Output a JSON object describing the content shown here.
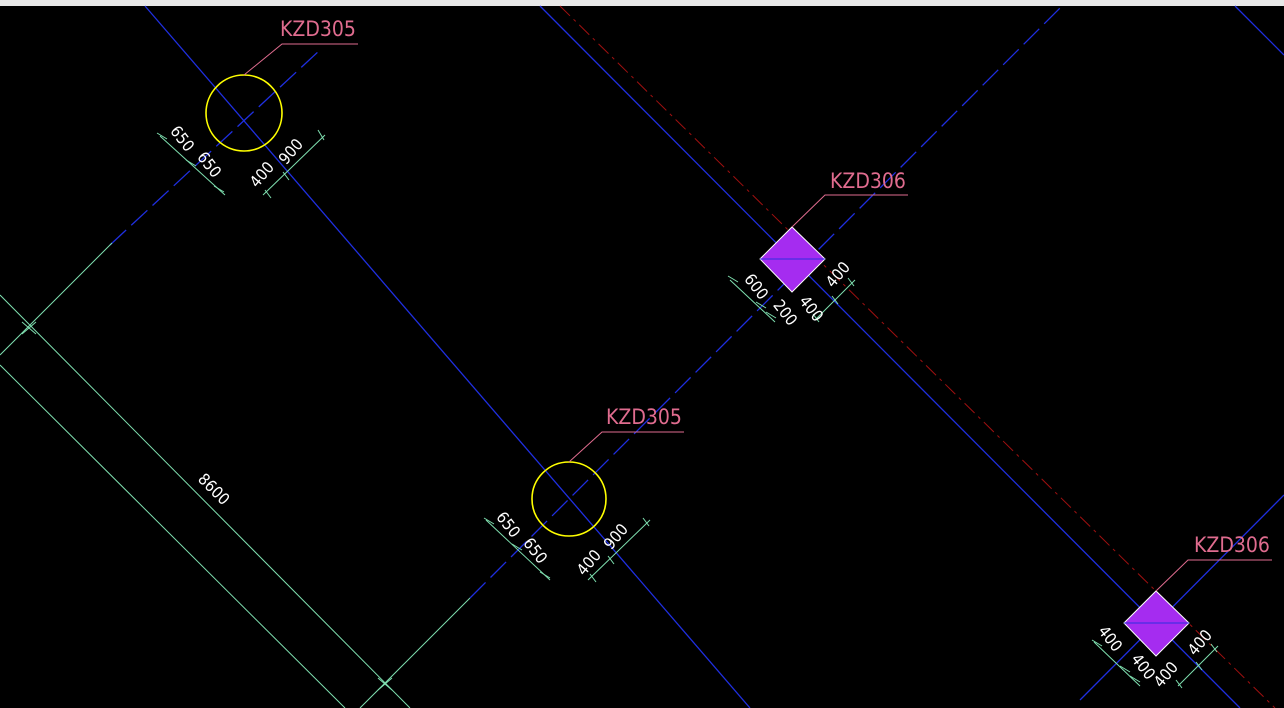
{
  "colors": {
    "background": "#000000",
    "top_strip": "#e8e8e8",
    "axis_blue": "#1f2fe0",
    "axis_red": "#a01010",
    "dim_green": "#7fe0b0",
    "leader_pink": "#e06c8f",
    "round_column": "#ffff00",
    "square_fill": "#a52cf0",
    "square_edge": "#ffffff"
  },
  "columns": [
    {
      "tag": "KZD305",
      "shape": "round-column",
      "dims": [
        "650",
        "650",
        "400",
        "900"
      ]
    },
    {
      "tag": "KZD306",
      "shape": "square-column",
      "dims": [
        "600",
        "200",
        "400",
        "400"
      ]
    },
    {
      "tag": "KZD305",
      "shape": "round-column",
      "dims": [
        "650",
        "650",
        "400",
        "900"
      ]
    },
    {
      "tag": "KZD306",
      "shape": "square-column",
      "dims": [
        "400",
        "400",
        "400",
        "400"
      ]
    }
  ],
  "grid_dimension": "8600"
}
